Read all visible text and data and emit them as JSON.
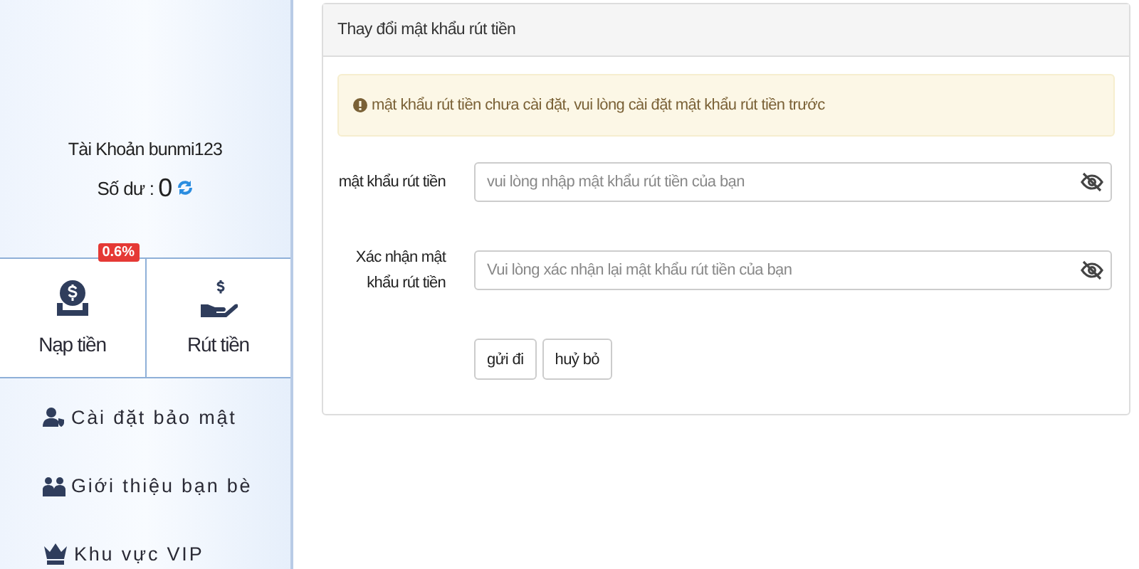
{
  "sidebar": {
    "account": "Tài Khoản bunmi123",
    "balance_label": "Số dư :",
    "balance": "0",
    "actions": [
      {
        "kind": "deposit",
        "label": "Nạp tiền",
        "badge": "0.6%"
      },
      {
        "kind": "withdraw",
        "label": "Rút tiền"
      }
    ],
    "menu": [
      {
        "kind": "security",
        "label": "Cài đặt bảo mật"
      },
      {
        "kind": "referral",
        "label": "Giới thiệu bạn bè"
      },
      {
        "kind": "vip",
        "label": "Khu vực VIP"
      }
    ]
  },
  "panel": {
    "title": "Thay đổi mật khẩu rút tiền",
    "alert": "mật khẩu rút tiền chưa cài đặt, vui lòng cài đặt mật khẩu rút tiền trước",
    "fields": [
      {
        "label": "mật khẩu rút tiền",
        "placeholder": "vui lòng nhập mật khẩu rút tiền của bạn"
      },
      {
        "label": "Xác nhận mật khẩu rút tiền",
        "placeholder": "Vui lòng xác nhận lại mật khẩu rút tiền của bạn"
      }
    ],
    "buttons": [
      "gửi đi",
      "huỷ bỏ"
    ]
  }
}
